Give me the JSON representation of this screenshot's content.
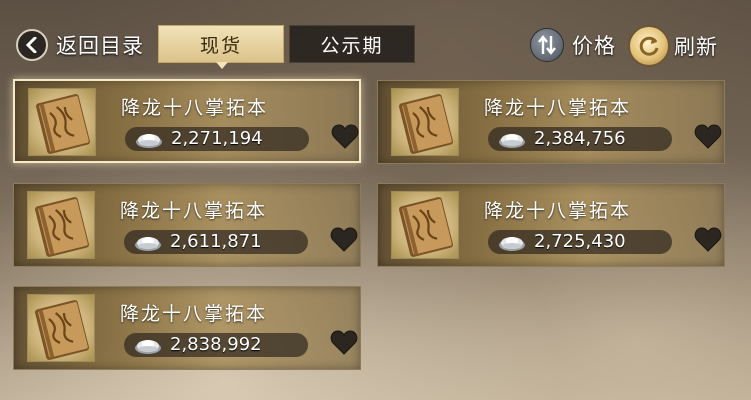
{
  "header": {
    "back_label": "返回目录",
    "tabs": [
      {
        "label": "现货",
        "active": true
      },
      {
        "label": "公示期",
        "active": false
      }
    ],
    "sort_label": "价格",
    "refresh_label": "刷新"
  },
  "listings": [
    {
      "name": "降龙十八掌拓本",
      "price": "2,271,194",
      "selected": true
    },
    {
      "name": "降龙十八掌拓本",
      "price": "2,384,756",
      "selected": false
    },
    {
      "name": "降龙十八掌拓本",
      "price": "2,611,871",
      "selected": false
    },
    {
      "name": "降龙十八掌拓本",
      "price": "2,725,430",
      "selected": false
    },
    {
      "name": "降龙十八掌拓本",
      "price": "2,838,992",
      "selected": false
    }
  ],
  "colors": {
    "tab_active": "#dcc38a",
    "card_gold": "#ac925e",
    "price_pill": "#302820"
  },
  "icons": [
    "back-arrow-icon",
    "sort-arrows-icon",
    "refresh-icon",
    "book-item-icon",
    "silver-ingot-icon",
    "heart-icon"
  ]
}
